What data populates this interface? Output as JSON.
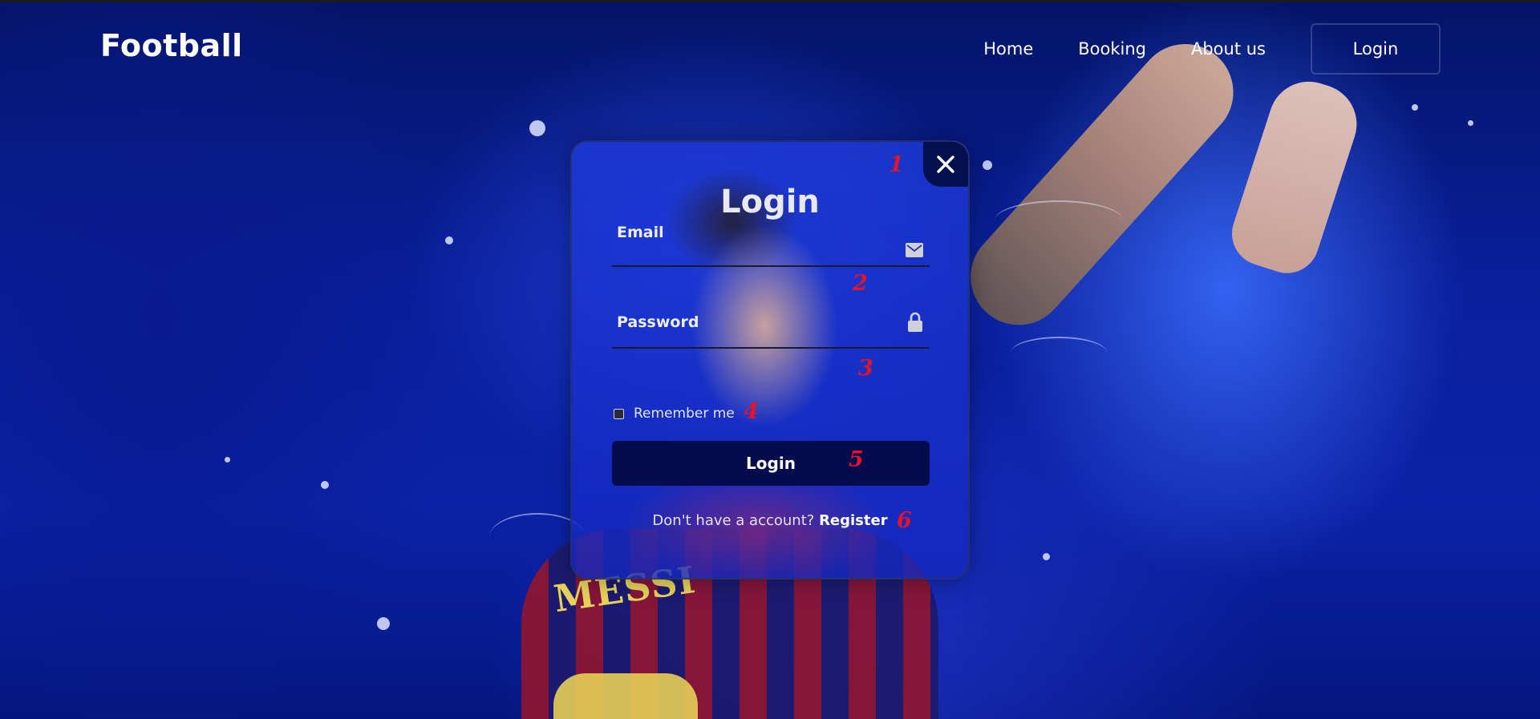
{
  "header": {
    "brand": "Football",
    "nav": [
      {
        "label": "Home"
      },
      {
        "label": "Booking"
      },
      {
        "label": "About us"
      }
    ],
    "login_button": "Login"
  },
  "background": {
    "jersey_name": "MESSI"
  },
  "modal": {
    "title": "Login",
    "email_label": "Email",
    "password_label": "Password",
    "remember_label": "Remember me",
    "remember_checked": false,
    "submit_label": "Login",
    "register_prompt": "Don't have a account?",
    "register_link": "Register",
    "icons": {
      "close": "close-icon",
      "email": "envelope-icon",
      "password": "lock-icon"
    }
  },
  "annotations": [
    "1",
    "2",
    "3",
    "4",
    "5",
    "6"
  ],
  "colors": {
    "background": "#0b22a8",
    "submit_button": "#040c4d",
    "annotation": "#e0142b"
  }
}
